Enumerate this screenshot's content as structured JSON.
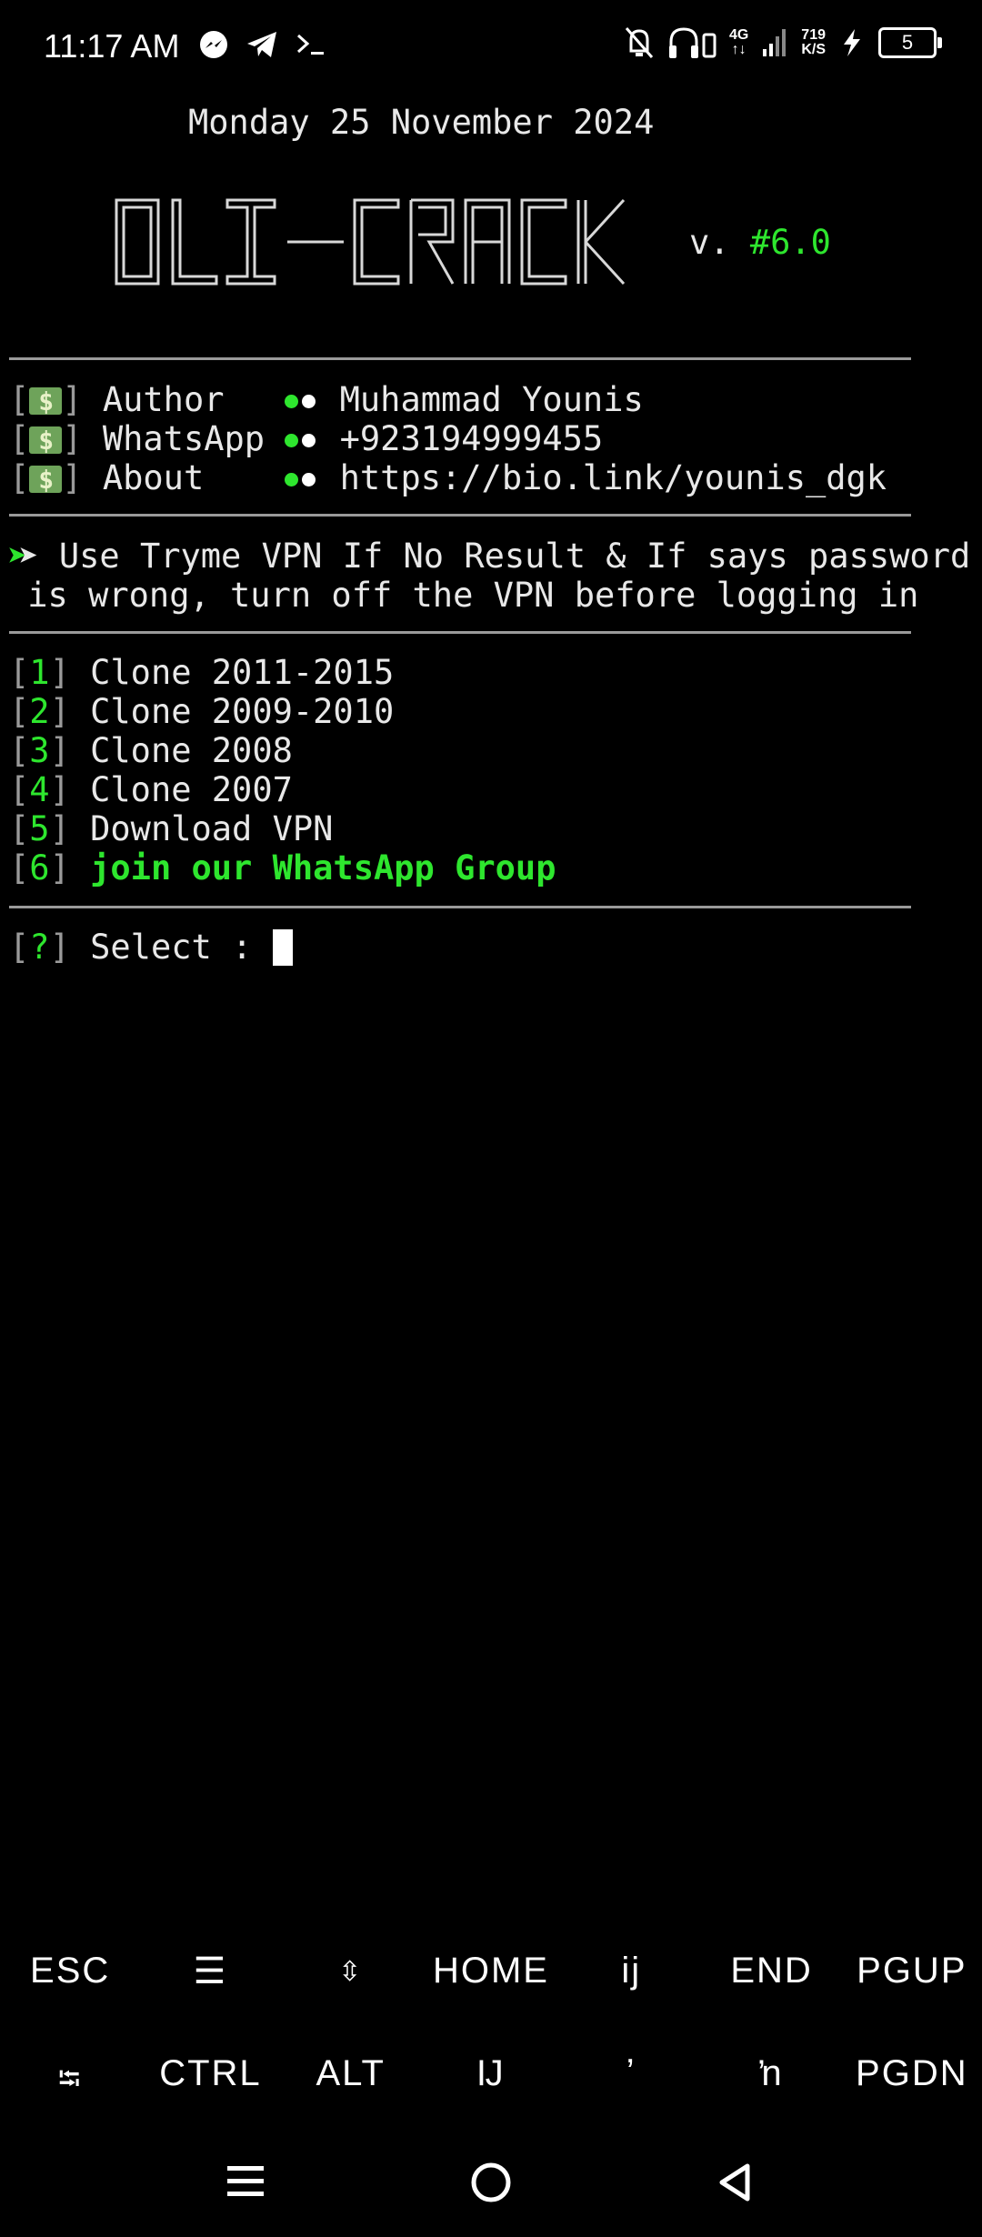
{
  "status_bar": {
    "time": "11:17 AM",
    "network_type": "4G",
    "net_speed_value": "719",
    "net_speed_unit": "K/S",
    "battery": "5",
    "icons": [
      "messenger-icon",
      "telegram-icon",
      "terminal-icon",
      "mute-bell-icon",
      "headphones-icon",
      "signal-icon",
      "charging-icon"
    ]
  },
  "terminal": {
    "date_line": "Monday 25 November 2024",
    "logo_text": "OLI-CRACK",
    "version_prefix": "v.",
    "version": "#6.0",
    "info": [
      {
        "label": "Author  ",
        "value": "Muhammad Younis"
      },
      {
        "label": "WhatsApp",
        "value": "+923194999455"
      },
      {
        "label": "About   ",
        "value": "https://bio.link/younis_dgk"
      }
    ],
    "notice_line1": " Use Tryme VPN If No Result & If says password",
    "notice_line2": " is wrong, turn off the VPN before logging in",
    "menu": [
      {
        "num": "1",
        "label": "Clone 2011-2015"
      },
      {
        "num": "2",
        "label": "Clone 2009-2010"
      },
      {
        "num": "3",
        "label": "Clone 2008"
      },
      {
        "num": "4",
        "label": "Clone 2007"
      },
      {
        "num": "5",
        "label": "Download VPN"
      },
      {
        "num": "6",
        "label": "join our WhatsApp Group"
      }
    ],
    "prompt_symbol": "?",
    "prompt_text": " Select : "
  },
  "extra_keys": {
    "row1": [
      "ESC",
      "☰",
      "⇳",
      "HOME",
      "ij",
      "END",
      "PGUP"
    ],
    "row2": [
      "⭾",
      "CTRL",
      "ALT",
      "Ĳ",
      "ʼ",
      "ŉ",
      "PGDN"
    ]
  },
  "colors": {
    "accent_green": "#2ee62e",
    "rule_gray": "#9a9a9a",
    "background": "#000000"
  }
}
